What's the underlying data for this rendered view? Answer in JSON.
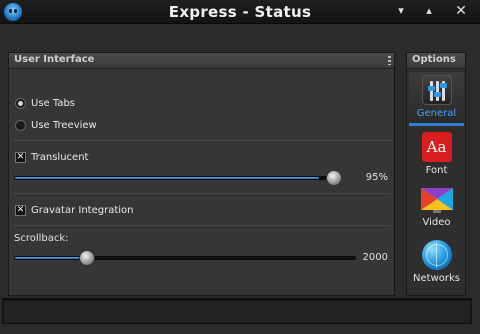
{
  "window": {
    "title": "Express - Status",
    "app_icon": "smiley-icon",
    "controls": {
      "minimize": "▾",
      "maximize": "▴",
      "close": "✕"
    }
  },
  "ui_panel": {
    "title": "User Interface",
    "radio_options": [
      {
        "label": "Use Tabs",
        "selected": true
      },
      {
        "label": "Use Treeview",
        "selected": false
      }
    ],
    "translucent": {
      "label": "Translucent",
      "checked": true,
      "value_text": "95%",
      "value": 0.95
    },
    "gravatar": {
      "label": "Gravatar Integration",
      "checked": true
    },
    "scrollback": {
      "label": "Scrollback:",
      "value_text": "2000",
      "value": 0.2
    }
  },
  "options": {
    "title": "Options",
    "items": [
      {
        "label": "General",
        "icon": "sliders-icon",
        "active": true
      },
      {
        "label": "Font",
        "icon": "font-icon",
        "icon_text": "Aa",
        "active": false
      },
      {
        "label": "Video",
        "icon": "video-icon",
        "active": false
      },
      {
        "label": "Networks",
        "icon": "globe-icon",
        "active": false
      }
    ]
  },
  "colors": {
    "accent": "#2f7fd8",
    "background": "#2b2b2b",
    "font_icon": "#d81e1e"
  }
}
